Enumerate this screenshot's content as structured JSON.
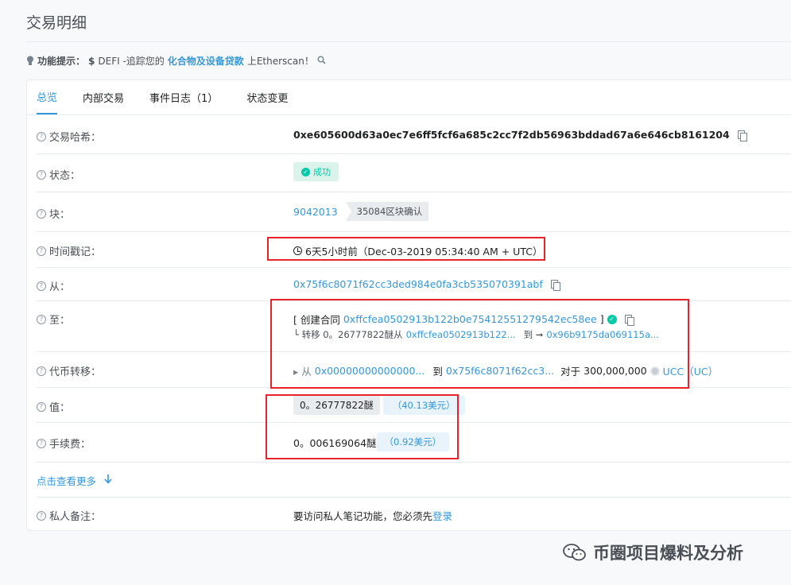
{
  "page_title": "交易明细",
  "tip": {
    "prefix": "功能提示：",
    "dollar": "$",
    "text1": "DEFI -追踪您的",
    "highlight": "化合物及设备贷款",
    "text2": "上Etherscan！"
  },
  "tabs": [
    "总览",
    "内部交易",
    "事件日志（1）",
    "状态变更"
  ],
  "rows": {
    "hash": {
      "label": "交易哈希：",
      "value": "0xe605600d63a0ec7e6ff5fcf6a685c2cc7f2db56963bddad67a6e646cb8161204"
    },
    "status": {
      "label": "状态：",
      "value": "成功"
    },
    "block": {
      "label": "块：",
      "value": "9042013",
      "confirmations": "35084区块确认"
    },
    "timestamp": {
      "label": "时间戳记：",
      "value": "6天5小时前（Dec-03-2019 05:34:40 AM + UTC）"
    },
    "from": {
      "label": "从：",
      "value": "0x75f6c8071f62cc3ded984e0fa3cb535070391abf"
    },
    "to": {
      "label": "至：",
      "bracket_open": "[ 创建合同",
      "contract": "0xffcfea0502913b122b0e75412551279542ec58ee",
      "bracket_close": "]",
      "sub_prefix": "└ 转移 0。26777822醚从",
      "sub_from": "0xffcfea0502913b122...",
      "sub_to_label": "到 ➞",
      "sub_to": "0x96b9175da069115a..."
    },
    "token": {
      "label": "代币转移：",
      "from_prefix": "▸ 从",
      "from": "0x00000000000000...",
      "to_label": "到",
      "to": "0x75f6c8071f62cc3...",
      "for_label": "对于",
      "amount": "300,000,000",
      "token_name": "UCC（UC）"
    },
    "value": {
      "label": "值：",
      "eth": "0。26777822醚",
      "usd": "（40.13美元）"
    },
    "fee": {
      "label": "手续费：",
      "eth": "0。006169064醚",
      "usd": "（0.92美元）"
    },
    "note": {
      "label": "私人备注：",
      "text": "要访问私人笔记功能，您必须先",
      "link": "登录"
    }
  },
  "more_link": "点击查看更多",
  "watermark": "币圈项目爆料及分析",
  "colors": {
    "link": "#3498db",
    "success": "#00c9a7",
    "highlight_box": "#e8232a"
  }
}
